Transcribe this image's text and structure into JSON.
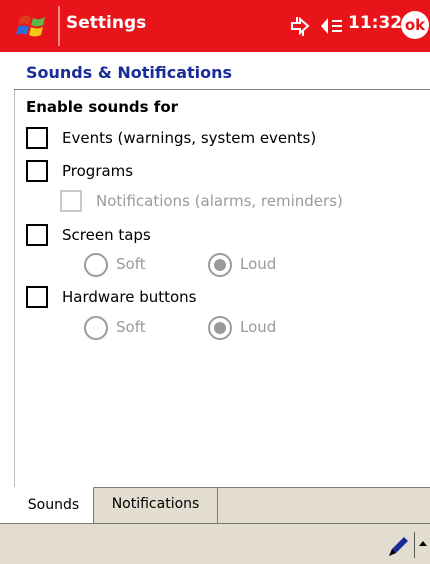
{
  "titlebar": {
    "app_title": "Settings",
    "clock": "11:32",
    "ok_label": "ok",
    "accent_color": "#e8141a"
  },
  "page": {
    "title": "Sounds & Notifications",
    "section_title": "Enable sounds for"
  },
  "options": {
    "events": {
      "label": "Events (warnings, system events)",
      "checked": false
    },
    "programs": {
      "label": "Programs",
      "checked": false
    },
    "notifications": {
      "label": "Notifications (alarms, reminders)",
      "checked": false,
      "enabled": false
    },
    "screen_taps": {
      "label": "Screen taps",
      "checked": false,
      "soft_label": "Soft",
      "loud_label": "Loud",
      "selected": "Loud",
      "enabled": false
    },
    "hardware_buttons": {
      "label": "Hardware buttons",
      "checked": false,
      "soft_label": "Soft",
      "loud_label": "Loud",
      "selected": "Loud",
      "enabled": false
    }
  },
  "tabs": [
    {
      "label": "Sounds",
      "active": true
    },
    {
      "label": "Notifications",
      "active": false
    }
  ],
  "icons": {
    "start": "windows-flag-icon",
    "connectivity": "connectivity-icon",
    "volume": "speaker-icon",
    "input": "pen-input-icon",
    "input_menu": "up-arrow-icon"
  }
}
